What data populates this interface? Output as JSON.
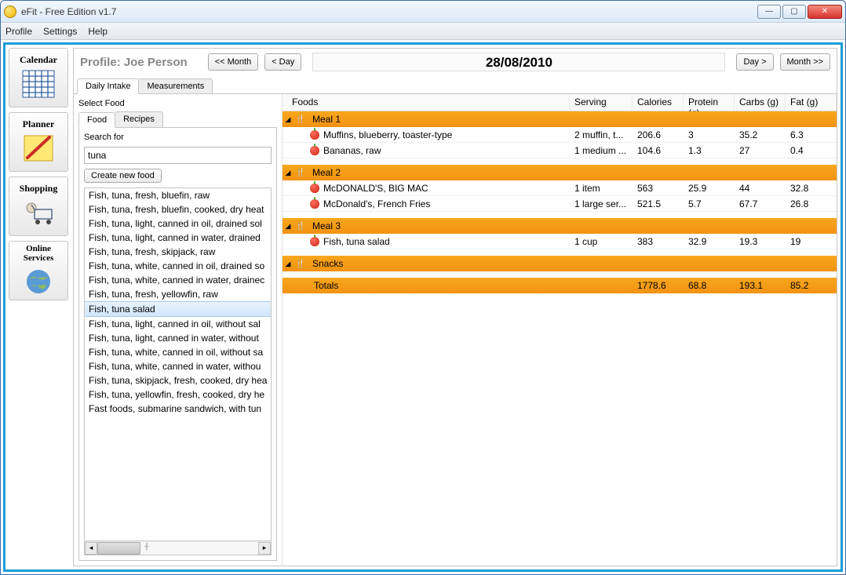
{
  "window": {
    "title": "eFit - Free Edition v1.7"
  },
  "menu": {
    "profile": "Profile",
    "settings": "Settings",
    "help": "Help"
  },
  "sidebar": {
    "calendar": "Calendar",
    "planner": "Planner",
    "shopping": "Shopping",
    "online": "Online Services"
  },
  "profile": {
    "label": "Profile: Joe Person"
  },
  "nav": {
    "month_prev": "<< Month",
    "day_prev": "< Day",
    "date": "28/08/2010",
    "day_next": "Day >",
    "month_next": "Month >>"
  },
  "tabs": {
    "daily_intake": "Daily Intake",
    "measurements": "Measurements"
  },
  "food_panel": {
    "select_food": "Select Food",
    "tab_food": "Food",
    "tab_recipes": "Recipes",
    "search_label": "Search for",
    "search_value": "tuna",
    "create_btn": "Create new food",
    "items": [
      "Fish, tuna, fresh, bluefin, raw",
      "Fish, tuna, fresh, bluefin, cooked, dry heat",
      "Fish, tuna, light, canned in oil, drained sol",
      "Fish, tuna, light, canned in water, drained",
      "Fish, tuna, fresh, skipjack, raw",
      "Fish, tuna, white, canned in oil, drained so",
      "Fish, tuna, white, canned in water, drainec",
      "Fish, tuna, fresh, yellowfin, raw",
      "Fish, tuna salad",
      "Fish, tuna, light, canned in oil, without sal",
      "Fish, tuna, light, canned in water, without",
      "Fish, tuna, white, canned in oil, without sa",
      "Fish, tuna, white, canned in water, withou",
      "Fish, tuna, skipjack, fresh, cooked, dry hea",
      "Fish, tuna, yellowfin, fresh, cooked, dry he",
      "Fast foods, submarine sandwich, with tun"
    ],
    "selected_index": 8
  },
  "diary": {
    "headers": {
      "foods": "Foods",
      "serving": "Serving",
      "calories": "Calories",
      "protein": "Protein (g)",
      "carbs": "Carbs (g)",
      "fat": "Fat (g)"
    },
    "meals": [
      {
        "name": "Meal 1",
        "items": [
          {
            "name": "Muffins, blueberry, toaster-type",
            "serving": "2 muffin, t...",
            "calories": "206.6",
            "protein": "3",
            "carbs": "35.2",
            "fat": "6.3"
          },
          {
            "name": "Bananas, raw",
            "serving": "1 medium ...",
            "calories": "104.6",
            "protein": "1.3",
            "carbs": "27",
            "fat": "0.4"
          }
        ]
      },
      {
        "name": "Meal 2",
        "items": [
          {
            "name": "McDONALD'S, BIG MAC",
            "serving": "1 item",
            "calories": "563",
            "protein": "25.9",
            "carbs": "44",
            "fat": "32.8"
          },
          {
            "name": "McDonald's, French Fries",
            "serving": "1 large ser...",
            "calories": "521.5",
            "protein": "5.7",
            "carbs": "67.7",
            "fat": "26.8"
          }
        ]
      },
      {
        "name": "Meal 3",
        "items": [
          {
            "name": "Fish, tuna salad",
            "serving": "1 cup",
            "calories": "383",
            "protein": "32.9",
            "carbs": "19.3",
            "fat": "19"
          }
        ]
      },
      {
        "name": "Snacks",
        "items": []
      }
    ],
    "totals": {
      "label": "Totals",
      "calories": "1778.6",
      "protein": "68.8",
      "carbs": "193.1",
      "fat": "85.2"
    }
  }
}
